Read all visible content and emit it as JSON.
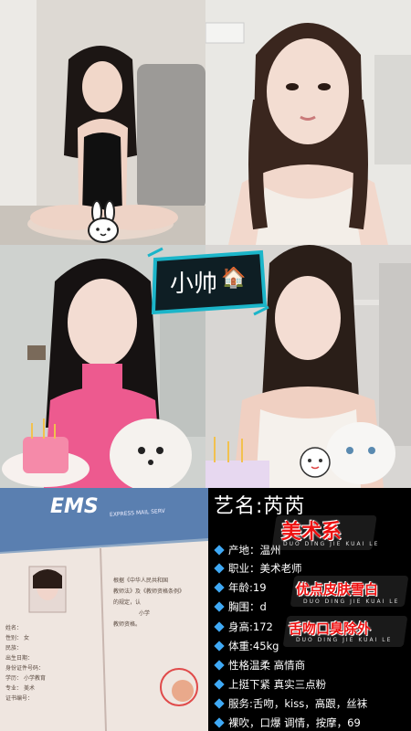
{
  "badge": {
    "text": "小帅",
    "house_icon": "🏠"
  },
  "info": {
    "title": "艺名:芮芮",
    "rows": [
      "产地：温州",
      "职业：美术老师",
      "年龄:19",
      "胸围：d",
      "身高:172",
      "体重:45kg",
      "性格温柔 高情商",
      "上挺下紧 真实三点粉",
      "服务:舌吻，kiss，高跟，丝袜",
      "裸吹，口爆 调情，按摩，69"
    ]
  },
  "stickers": {
    "s1": {
      "text": "美术系",
      "sub": "DUO DING JIE KUAI LE"
    },
    "s2": {
      "text": "优点皮肤雪白",
      "sub": "DUO DING JIE KUAI LE"
    },
    "s3": {
      "text": "舌吻口臭除外",
      "sub": "DUO DING JIE KUAI LE"
    }
  },
  "document": {
    "ems_logo": "EMS",
    "ems_caption": "EXPRESS MAIL SERV",
    "cert_text_1": "根据《中华人民共和国",
    "cert_text_2": "教师法》及《教师资格条例》",
    "cert_text_3": "的规定，认",
    "cert_text_4": "小学",
    "cert_text_5": "教师资格。",
    "field_labels": [
      "姓名：",
      "性别：",
      "民族：",
      "出生日期：",
      "身份证件号码：",
      "学历：",
      "专业：",
      "证书编号："
    ],
    "field_values": [
      "",
      "女",
      "",
      "",
      "",
      "小学教育",
      "美术",
      ""
    ]
  },
  "colors": {
    "accent": "#3fa9f5",
    "sticker_red": "#e11111",
    "badge_teal": "#1bb5c9"
  }
}
